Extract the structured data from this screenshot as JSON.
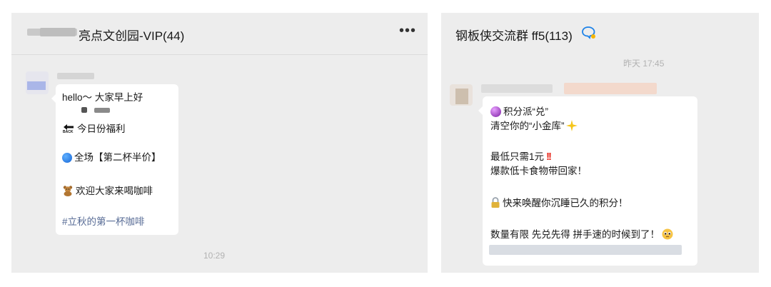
{
  "left_chat": {
    "title": "亮点文创园-VIP(44)",
    "more_label": "•••",
    "message": {
      "line1": "hello～ 大家早上好",
      "line2_label": "今日份福利",
      "back_icon_text": "BACK",
      "line3": "全场【第二杯半价】",
      "line4": "欢迎大家来喝咖啡",
      "hashtag": "#立秋的第一杯咖啡"
    },
    "time": "10:29"
  },
  "right_chat": {
    "title": "钢板侠交流群 ff5(113)",
    "time": "昨天 17:45",
    "message": {
      "line1": "积分派“兑”",
      "line2": "清空你的“小金库”",
      "line3": "最低只需1元",
      "line4": "爆款低卡食物带回家！",
      "line5": "快来唤醒你沉睡已久的积分！",
      "line6": "数量有限 先兑先得 拼手速的时候到了！"
    }
  },
  "colors": {
    "panel_bg": "#ededed",
    "bubble_bg": "#ffffff",
    "hashtag": "#576b95",
    "time": "#b2b2b2",
    "accent_icon": "#1d82e8",
    "red_exclaim": "#e8281c"
  },
  "icons": [
    "more-icon",
    "back-arrow-icon",
    "blue-circle-icon",
    "bear-icon",
    "chat-bubbles-icon",
    "crystal-ball-icon",
    "sparkle-icon",
    "double-exclamation-icon",
    "lock-icon",
    "pleading-face-icon"
  ]
}
